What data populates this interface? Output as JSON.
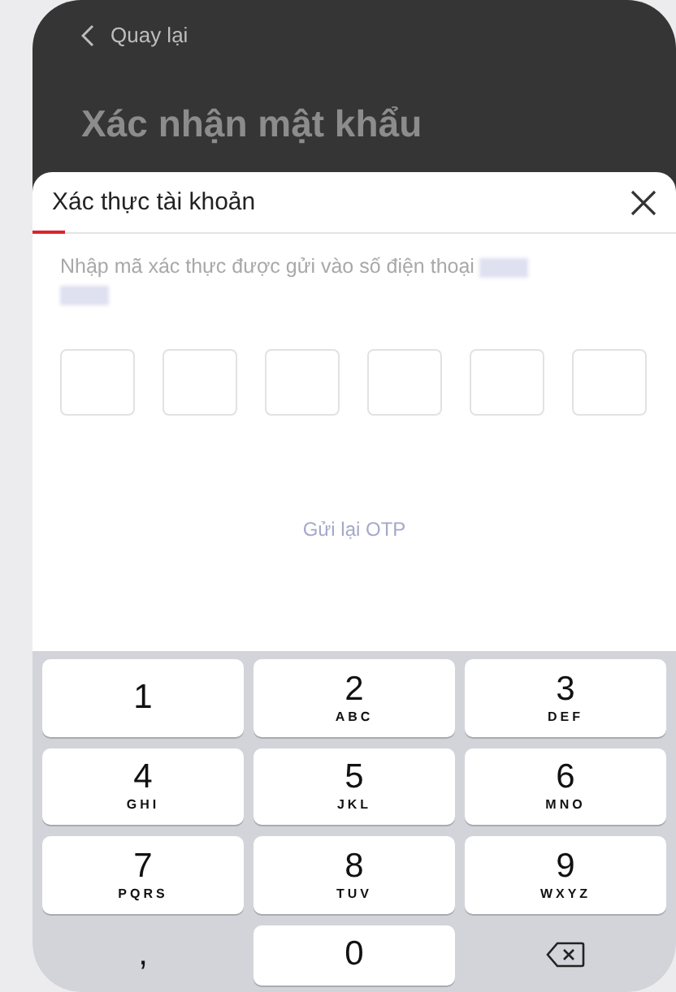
{
  "header": {
    "back_label": "Quay lại",
    "page_title": "Xác nhận mật khẩu"
  },
  "sheet": {
    "title": "Xác thực tài khoản",
    "instruction": "Nhập mã xác thực được gửi vào số điện thoại",
    "phone_redacted": true,
    "otp_boxes": [
      {
        "filled": false
      },
      {
        "filled": false
      },
      {
        "filled": false
      },
      {
        "filled": false
      },
      {
        "filled": false
      },
      {
        "filled": false
      }
    ],
    "resend_label": "Gửi lại OTP"
  },
  "keypad": [
    {
      "kind": "digit",
      "digit": "1"
    },
    {
      "kind": "digit",
      "digit": "2",
      "letters": "ABC"
    },
    {
      "kind": "digit",
      "digit": "3",
      "letters": "DEF"
    },
    {
      "kind": "digit",
      "digit": "4",
      "letters": "GHI"
    },
    {
      "kind": "digit",
      "digit": "5",
      "letters": "JKL"
    },
    {
      "kind": "digit",
      "digit": "6",
      "letters": "MNO"
    },
    {
      "kind": "digit",
      "digit": "7",
      "letters": "PQRS"
    },
    {
      "kind": "digit",
      "digit": "8",
      "letters": "TUV"
    },
    {
      "kind": "digit",
      "digit": "9",
      "letters": "WXYZ"
    },
    {
      "kind": "symbol",
      "digit": ","
    },
    {
      "kind": "digit",
      "digit": "0"
    },
    {
      "kind": "delete"
    }
  ]
}
